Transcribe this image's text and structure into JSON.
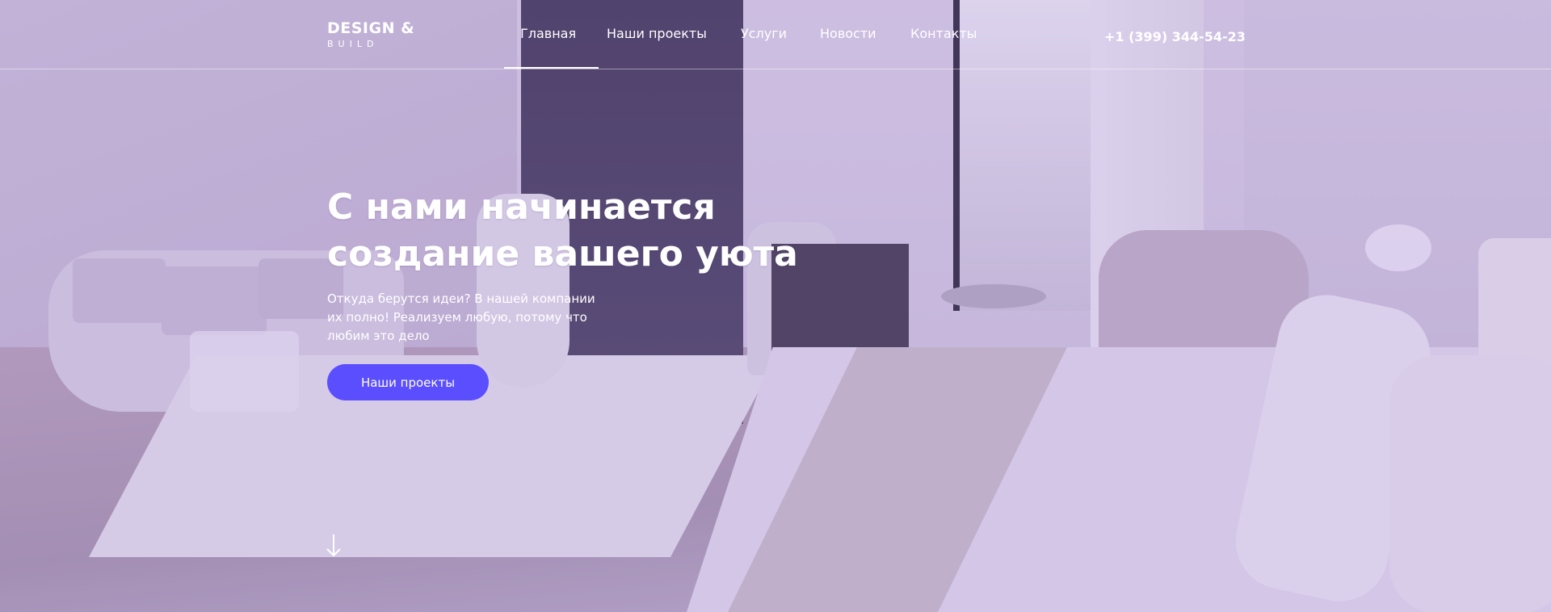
{
  "brand": {
    "name": "DESIGN &",
    "tagline": "BUILD"
  },
  "nav": {
    "items": [
      {
        "label": "Главная",
        "active": true
      },
      {
        "label": "Наши проекты",
        "active": false
      },
      {
        "label": "Услуги",
        "active": false
      },
      {
        "label": "Новости",
        "active": false
      },
      {
        "label": "Контакты",
        "active": false
      }
    ]
  },
  "contact": {
    "phone": "+1 (399) 344-54-23"
  },
  "hero": {
    "title_line1": "С нами начинается",
    "title_line2": "создание вашего уюта",
    "subtitle": "Откуда берутся идеи? В нашей компании их полно! Реализуем любую, потому что любим это дело",
    "cta_label": "Наши проекты",
    "scroll_icon": "arrow-down-icon"
  },
  "colors": {
    "accent": "#5b4efe",
    "overlay": "#9678d2",
    "text": "#ffffff"
  }
}
